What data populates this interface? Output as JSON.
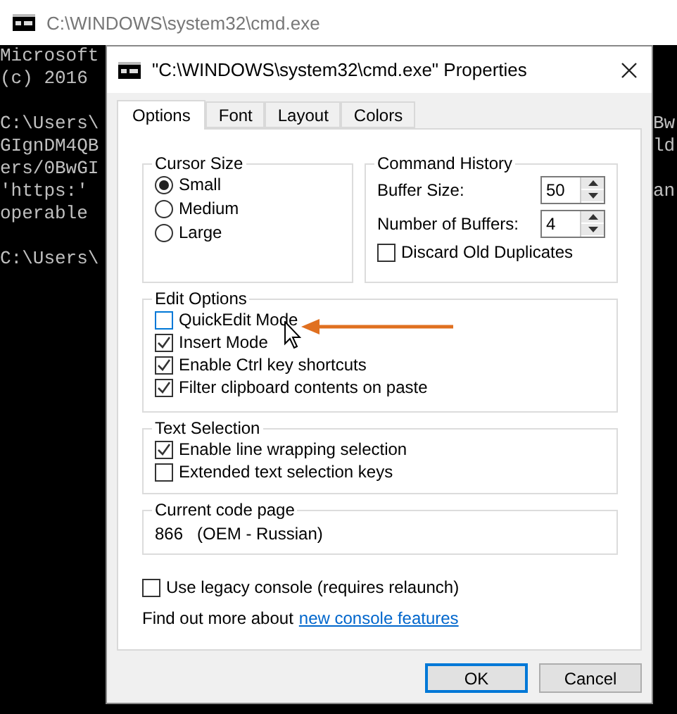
{
  "console": {
    "title": "C:\\WINDOWS\\system32\\cmd.exe",
    "blocks": [
      [
        {
          "left": "Microsoft"
        },
        {
          "left": "(c) 2016"
        }
      ],
      [
        {
          "left": "C:\\Users\\",
          "right": "Bw"
        },
        {
          "left": "GIgnDM4QB",
          "right": "ld"
        },
        {
          "left": "ers/0BwGI"
        },
        {
          "left": "'https:'",
          "right": "an"
        },
        {
          "left": "operable"
        }
      ],
      [
        {
          "left": "C:\\Users\\"
        }
      ]
    ]
  },
  "dialog": {
    "title": "\"C:\\WINDOWS\\system32\\cmd.exe\" Properties",
    "tabs": [
      {
        "label": "Options",
        "selected": true
      },
      {
        "label": "Font",
        "selected": false
      },
      {
        "label": "Layout",
        "selected": false
      },
      {
        "label": "Colors",
        "selected": false
      }
    ],
    "cursor_size": {
      "title": "Cursor Size",
      "options": [
        {
          "label": "Small",
          "selected": true
        },
        {
          "label": "Medium",
          "selected": false
        },
        {
          "label": "Large",
          "selected": false
        }
      ]
    },
    "command_history": {
      "title": "Command History",
      "fields": [
        {
          "label": "Buffer Size:",
          "value": "50"
        },
        {
          "label": "Number of Buffers:",
          "value": "4"
        }
      ],
      "checkbox": {
        "label": "Discard Old Duplicates",
        "checked": false
      }
    },
    "edit_options": {
      "title": "Edit Options",
      "items": [
        {
          "label": "QuickEdit Mode",
          "checked": false,
          "focused": true
        },
        {
          "label": "Insert Mode",
          "checked": true,
          "focused": false
        },
        {
          "label": "Enable Ctrl key shortcuts",
          "checked": true,
          "focused": false
        },
        {
          "label": "Filter clipboard contents on paste",
          "checked": true,
          "focused": false
        }
      ]
    },
    "text_selection": {
      "title": "Text Selection",
      "items": [
        {
          "label": "Enable line wrapping selection",
          "checked": true,
          "focused": false
        },
        {
          "label": "Extended text selection keys",
          "checked": false,
          "focused": false
        }
      ]
    },
    "code_page": {
      "title": "Current code page",
      "value": "866   (OEM - Russian)"
    },
    "legacy": {
      "label": "Use legacy console (requires relaunch)",
      "checked": false
    },
    "more_info": {
      "text": "Find out more about",
      "link": "new console features"
    },
    "buttons": [
      {
        "label": "OK",
        "default": true
      },
      {
        "label": "Cancel",
        "default": false
      }
    ]
  }
}
